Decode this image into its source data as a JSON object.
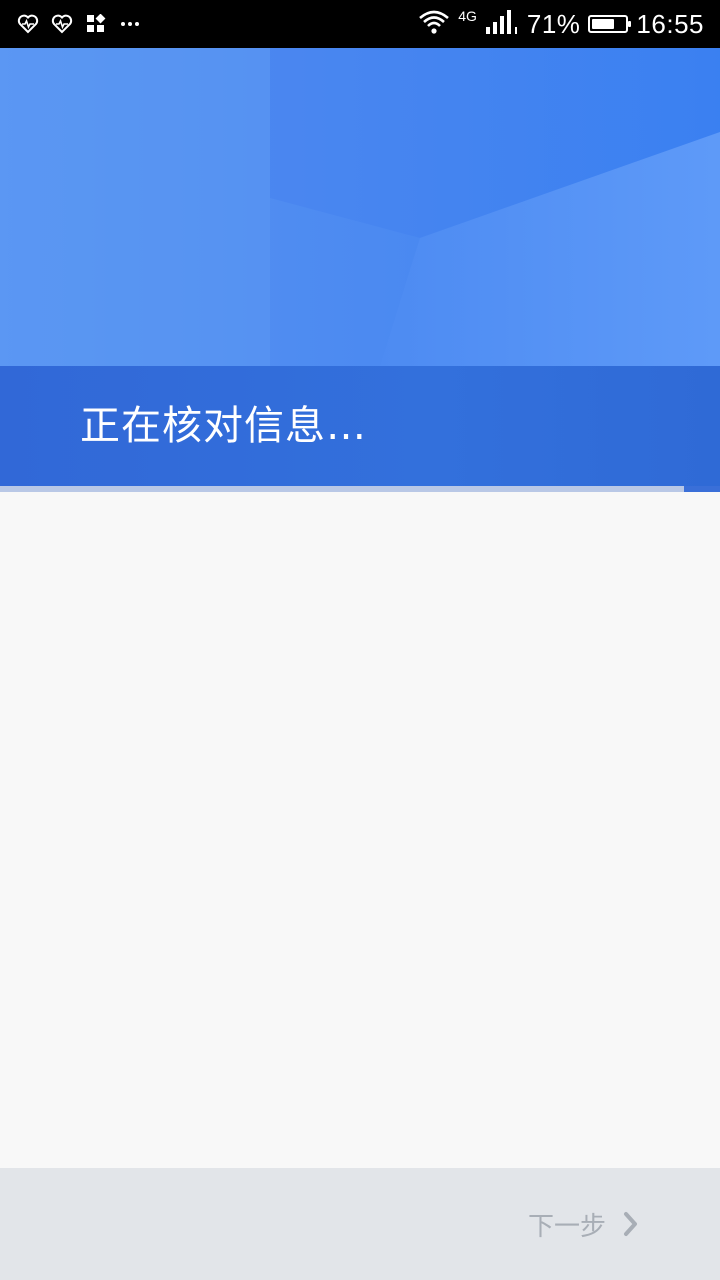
{
  "status_bar": {
    "left_icons": [
      "heart-rate-icon",
      "heart-rate-icon",
      "apps-grid-icon",
      "more-dots-icon"
    ],
    "network_label": "4G",
    "battery_percent_text": "71%",
    "battery_level": 0.71,
    "time": "16:55"
  },
  "header": {
    "title": "正在核对信息…",
    "progress": 0.95
  },
  "footer": {
    "next_label": "下一步",
    "next_icon": "chevron-right-icon"
  },
  "colors": {
    "hero_blue": "#4f8cf1",
    "band_blue": "#3370dc",
    "disabled_text": "#a8aeb6"
  }
}
